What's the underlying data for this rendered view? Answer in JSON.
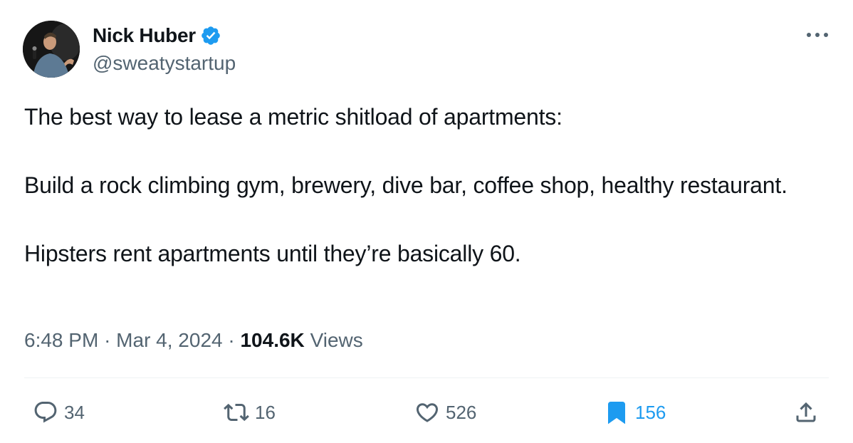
{
  "author": {
    "name": "Nick Huber",
    "handle": "@sweatystartup",
    "verified": true
  },
  "tweet": {
    "paragraphs": [
      "The best way to lease a metric shitload of apartments:",
      "Build a rock climbing gym, brewery, dive bar, coffee shop, healthy restaurant.",
      "Hipsters rent apartments until they’re basically 60."
    ]
  },
  "meta": {
    "time": "6:48 PM",
    "separator": "·",
    "date": "Mar 4, 2024",
    "views_count": "104.6K",
    "views_label": "Views"
  },
  "actions": {
    "replies": "34",
    "reposts": "16",
    "likes": "526",
    "bookmarks": "156"
  },
  "colors": {
    "text": "#0f1419",
    "secondary": "#536471",
    "accent": "#1d9bf0",
    "divider": "#eff3f4"
  },
  "icons": {
    "more": "ellipsis-icon",
    "verified": "verified-badge-icon",
    "reply": "reply-icon",
    "repost": "repost-icon",
    "like": "heart-icon",
    "bookmark": "bookmark-icon",
    "share": "share-icon"
  }
}
